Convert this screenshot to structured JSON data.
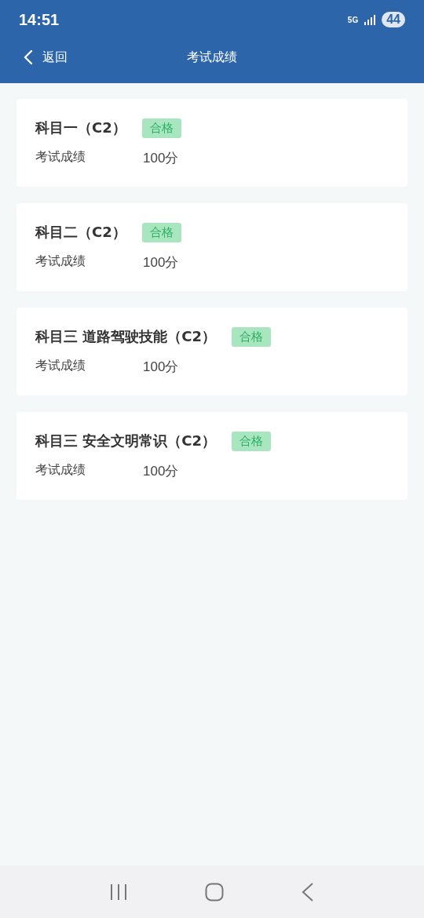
{
  "status_bar": {
    "time": "14:51",
    "network": "5G",
    "battery": "44"
  },
  "nav_bar": {
    "back": "返回",
    "title": "考试成绩"
  },
  "results": [
    {
      "subject": "科目一（C2）",
      "result": "合格",
      "label": "考试成绩",
      "score": "100分"
    },
    {
      "subject": "科目二（C2）",
      "result": "合格",
      "label": "考试成绩",
      "score": "100分"
    },
    {
      "subject": "科目三 道路驾驶技能（C2）",
      "result": "合格",
      "label": "考试成绩",
      "score": "100分"
    },
    {
      "subject": "科目三 安全文明常识（C2）",
      "result": "合格",
      "label": "考试成绩",
      "score": "100分"
    }
  ]
}
